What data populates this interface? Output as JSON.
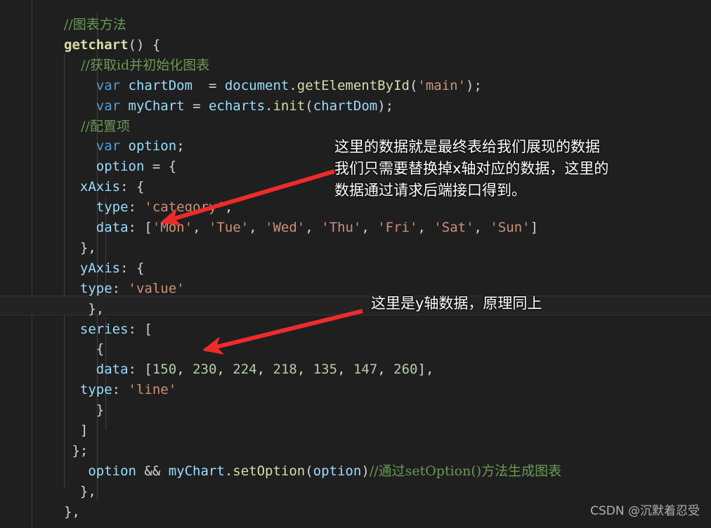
{
  "editor": {
    "background_color": "#1f1f1f",
    "current_line_color": "#232323",
    "colors": {
      "comment": "#6A9955",
      "keyword": "#569CD6",
      "variable": "#9CDCFE",
      "function": "#DCDCAA",
      "string": "#CE9178",
      "number": "#B5CEA8",
      "plain": "#D4D4D4",
      "annotation": "#FFFFFF",
      "arrow": "#EE2B2B"
    },
    "code_lines": [
      {
        "indent": 0,
        "tokens": [
          {
            "text": "//图表方法",
            "cls": "t-comment cjk-comment"
          }
        ]
      },
      {
        "indent": 0,
        "tokens": [
          {
            "text": "getchart",
            "cls": "t-func bold"
          },
          {
            "text": "() {",
            "cls": "t-punct"
          }
        ]
      },
      {
        "indent": 0,
        "tokens": [
          {
            "text": "    //获取id并初始化图表",
            "cls": "t-comment cjk-comment"
          }
        ]
      },
      {
        "indent": 0,
        "tokens": [
          {
            "text": "    ",
            "cls": "t-plain"
          },
          {
            "text": "var",
            "cls": "t-keyword"
          },
          {
            "text": " ",
            "cls": "t-plain"
          },
          {
            "text": "chartDom",
            "cls": "t-var"
          },
          {
            "text": "  = ",
            "cls": "t-plain"
          },
          {
            "text": "document",
            "cls": "t-var"
          },
          {
            "text": ".",
            "cls": "t-plain"
          },
          {
            "text": "getElementById",
            "cls": "t-func"
          },
          {
            "text": "(",
            "cls": "t-plain"
          },
          {
            "text": "'main'",
            "cls": "t-string"
          },
          {
            "text": ");",
            "cls": "t-plain"
          }
        ]
      },
      {
        "indent": 0,
        "tokens": [
          {
            "text": "    ",
            "cls": "t-plain"
          },
          {
            "text": "var",
            "cls": "t-keyword"
          },
          {
            "text": " ",
            "cls": "t-plain"
          },
          {
            "text": "myChart",
            "cls": "t-var"
          },
          {
            "text": " = ",
            "cls": "t-plain"
          },
          {
            "text": "echarts",
            "cls": "t-var"
          },
          {
            "text": ".",
            "cls": "t-plain"
          },
          {
            "text": "init",
            "cls": "t-func"
          },
          {
            "text": "(",
            "cls": "t-plain"
          },
          {
            "text": "chartDom",
            "cls": "t-var"
          },
          {
            "text": ");",
            "cls": "t-plain"
          }
        ]
      },
      {
        "indent": 0,
        "tokens": [
          {
            "text": "    //配置项",
            "cls": "t-comment cjk-comment"
          }
        ]
      },
      {
        "indent": 0,
        "tokens": [
          {
            "text": "    ",
            "cls": "t-plain"
          },
          {
            "text": "var",
            "cls": "t-keyword"
          },
          {
            "text": " ",
            "cls": "t-plain"
          },
          {
            "text": "option",
            "cls": "t-var"
          },
          {
            "text": ";",
            "cls": "t-plain"
          }
        ]
      },
      {
        "indent": 0,
        "tokens": [
          {
            "text": "    ",
            "cls": "t-plain"
          },
          {
            "text": "option",
            "cls": "t-var"
          },
          {
            "text": " = {",
            "cls": "t-plain"
          }
        ]
      },
      {
        "indent": 0,
        "tokens": [
          {
            "text": "  ",
            "cls": "t-plain"
          },
          {
            "text": "xAxis",
            "cls": "t-prop"
          },
          {
            "text": ": {",
            "cls": "t-plain"
          }
        ]
      },
      {
        "indent": 0,
        "tokens": [
          {
            "text": "    ",
            "cls": "t-plain"
          },
          {
            "text": "type",
            "cls": "t-prop"
          },
          {
            "text": ": ",
            "cls": "t-plain"
          },
          {
            "text": "'category'",
            "cls": "t-string"
          },
          {
            "text": ",",
            "cls": "t-plain"
          }
        ]
      },
      {
        "indent": 0,
        "tokens": [
          {
            "text": "    ",
            "cls": "t-plain"
          },
          {
            "text": "data",
            "cls": "t-prop"
          },
          {
            "text": ": [",
            "cls": "t-plain"
          },
          {
            "text": "'Mon'",
            "cls": "t-string"
          },
          {
            "text": ", ",
            "cls": "t-plain"
          },
          {
            "text": "'Tue'",
            "cls": "t-string"
          },
          {
            "text": ", ",
            "cls": "t-plain"
          },
          {
            "text": "'Wed'",
            "cls": "t-string"
          },
          {
            "text": ", ",
            "cls": "t-plain"
          },
          {
            "text": "'Thu'",
            "cls": "t-string"
          },
          {
            "text": ", ",
            "cls": "t-plain"
          },
          {
            "text": "'Fri'",
            "cls": "t-string"
          },
          {
            "text": ", ",
            "cls": "t-plain"
          },
          {
            "text": "'Sat'",
            "cls": "t-string"
          },
          {
            "text": ", ",
            "cls": "t-plain"
          },
          {
            "text": "'Sun'",
            "cls": "t-string"
          },
          {
            "text": "]",
            "cls": "t-plain"
          }
        ]
      },
      {
        "indent": 0,
        "tokens": [
          {
            "text": "  },",
            "cls": "t-plain"
          }
        ]
      },
      {
        "indent": 0,
        "tokens": [
          {
            "text": "  ",
            "cls": "t-plain"
          },
          {
            "text": "yAxis",
            "cls": "t-prop"
          },
          {
            "text": ": {",
            "cls": "t-plain"
          }
        ]
      },
      {
        "indent": 0,
        "tokens": [
          {
            "text": "  ",
            "cls": "t-plain"
          },
          {
            "text": "type",
            "cls": "t-prop"
          },
          {
            "text": ": ",
            "cls": "t-plain"
          },
          {
            "text": "'value'",
            "cls": "t-string"
          }
        ]
      },
      {
        "indent": 0,
        "tokens": [
          {
            "text": "   },",
            "cls": "t-plain"
          }
        ]
      },
      {
        "indent": 0,
        "tokens": [
          {
            "text": "  ",
            "cls": "t-plain"
          },
          {
            "text": "series",
            "cls": "t-prop"
          },
          {
            "text": ": [",
            "cls": "t-plain"
          }
        ]
      },
      {
        "indent": 0,
        "tokens": [
          {
            "text": "    {",
            "cls": "t-plain"
          }
        ]
      },
      {
        "indent": 0,
        "tokens": [
          {
            "text": "    ",
            "cls": "t-plain"
          },
          {
            "text": "data",
            "cls": "t-prop"
          },
          {
            "text": ": [",
            "cls": "t-plain"
          },
          {
            "text": "150",
            "cls": "t-number"
          },
          {
            "text": ", ",
            "cls": "t-plain"
          },
          {
            "text": "230",
            "cls": "t-number"
          },
          {
            "text": ", ",
            "cls": "t-plain"
          },
          {
            "text": "224",
            "cls": "t-number"
          },
          {
            "text": ", ",
            "cls": "t-plain"
          },
          {
            "text": "218",
            "cls": "t-number"
          },
          {
            "text": ", ",
            "cls": "t-plain"
          },
          {
            "text": "135",
            "cls": "t-number"
          },
          {
            "text": ", ",
            "cls": "t-plain"
          },
          {
            "text": "147",
            "cls": "t-number"
          },
          {
            "text": ", ",
            "cls": "t-plain"
          },
          {
            "text": "260",
            "cls": "t-number"
          },
          {
            "text": "],",
            "cls": "t-plain"
          }
        ]
      },
      {
        "indent": 0,
        "tokens": [
          {
            "text": "  ",
            "cls": "t-plain"
          },
          {
            "text": "type",
            "cls": "t-prop"
          },
          {
            "text": ": ",
            "cls": "t-plain"
          },
          {
            "text": "'line'",
            "cls": "t-string"
          }
        ]
      },
      {
        "indent": 0,
        "tokens": [
          {
            "text": "    }",
            "cls": "t-plain"
          }
        ]
      },
      {
        "indent": 0,
        "tokens": [
          {
            "text": "  ]",
            "cls": "t-plain"
          }
        ]
      },
      {
        "indent": 0,
        "tokens": [
          {
            "text": " };",
            "cls": "t-plain"
          }
        ]
      },
      {
        "indent": 0,
        "tokens": [
          {
            "text": "   ",
            "cls": "t-plain"
          },
          {
            "text": "option",
            "cls": "t-var"
          },
          {
            "text": " && ",
            "cls": "t-plain"
          },
          {
            "text": "myChart",
            "cls": "t-var"
          },
          {
            "text": ".",
            "cls": "t-plain"
          },
          {
            "text": "setOption",
            "cls": "t-func"
          },
          {
            "text": "(",
            "cls": "t-plain"
          },
          {
            "text": "option",
            "cls": "t-var"
          },
          {
            "text": ")",
            "cls": "t-plain"
          },
          {
            "text": "//通过setOption()方法生成图表",
            "cls": "t-comment cjk-comment"
          }
        ]
      },
      {
        "indent": 0,
        "tokens": [
          {
            "text": "  },",
            "cls": "t-plain"
          }
        ]
      },
      {
        "indent": 0,
        "tokens": [
          {
            "text": "},",
            "cls": "t-plain"
          }
        ]
      }
    ],
    "annotations": [
      {
        "id": "xaxis-note",
        "lines": [
          "这里的数据就是最终表给我们展现的数据",
          "我们只需要替换掉x轴对应的数据，这里的",
          "数据通过请求后端接口得到。"
        ]
      },
      {
        "id": "yaxis-note",
        "lines": [
          "这里是y轴数据，原理同上"
        ]
      }
    ]
  },
  "watermark": {
    "text": "CSDN @沉默着忍受"
  }
}
